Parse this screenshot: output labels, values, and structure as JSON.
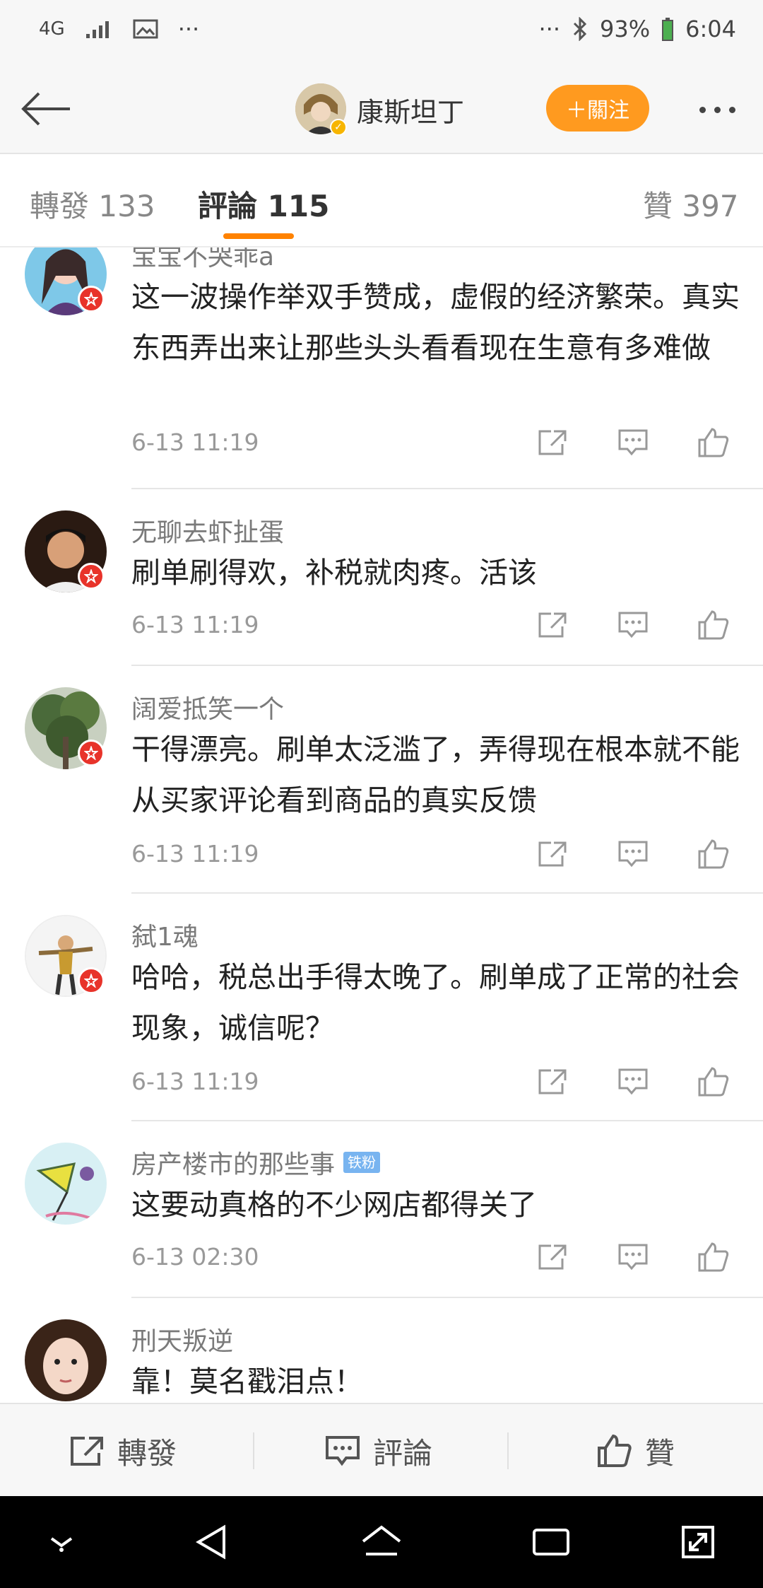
{
  "status_bar": {
    "network": "4G",
    "battery": "93%",
    "time": "6:04",
    "more_left": "···",
    "more_right": "···"
  },
  "header": {
    "username": "康斯坦丁",
    "follow_label": "＋關注"
  },
  "tabs": [
    {
      "label": "轉發 133"
    },
    {
      "label": "評論 115"
    },
    {
      "label": "贊 397"
    }
  ],
  "comments": [
    {
      "name": "宝宝不哭乖a",
      "text": "这一波操作举双手赞成，虚假的经济繁荣。真实东西弄出来让那些头头看看现在生意有多难做",
      "time": "6-13 11:19"
    },
    {
      "name": "无聊去虾扯蛋",
      "text": "刷单刷得欢，补税就肉疼。活该",
      "time": "6-13 11:19"
    },
    {
      "name": "阔爱抵笑一个",
      "text": "干得漂亮。刷单太泛滥了，弄得现在根本就不能从买家评论看到商品的真实反馈",
      "time": "6-13 11:19"
    },
    {
      "name": "弑1魂",
      "text": "哈哈，税总出手得太晚了。刷单成了正常的社会现象，诚信呢？",
      "time": "6-13 11:19"
    },
    {
      "name": "房产楼市的那些事",
      "badge": "铁粉",
      "text": "这要动真格的不少网店都得关了",
      "time": "6-13 02:30"
    },
    {
      "name": "刑天叛逆",
      "text": "靠！莫名戳泪点！",
      "time": ""
    }
  ],
  "action_bar": {
    "repost_label": "轉發",
    "comment_label": "評論",
    "like_label": "贊"
  },
  "colors": {
    "accent": "#ff8200",
    "follow_button": "#ff9a1f",
    "verified_badge": "#e8332a",
    "fan_badge": "#78b4f0"
  }
}
